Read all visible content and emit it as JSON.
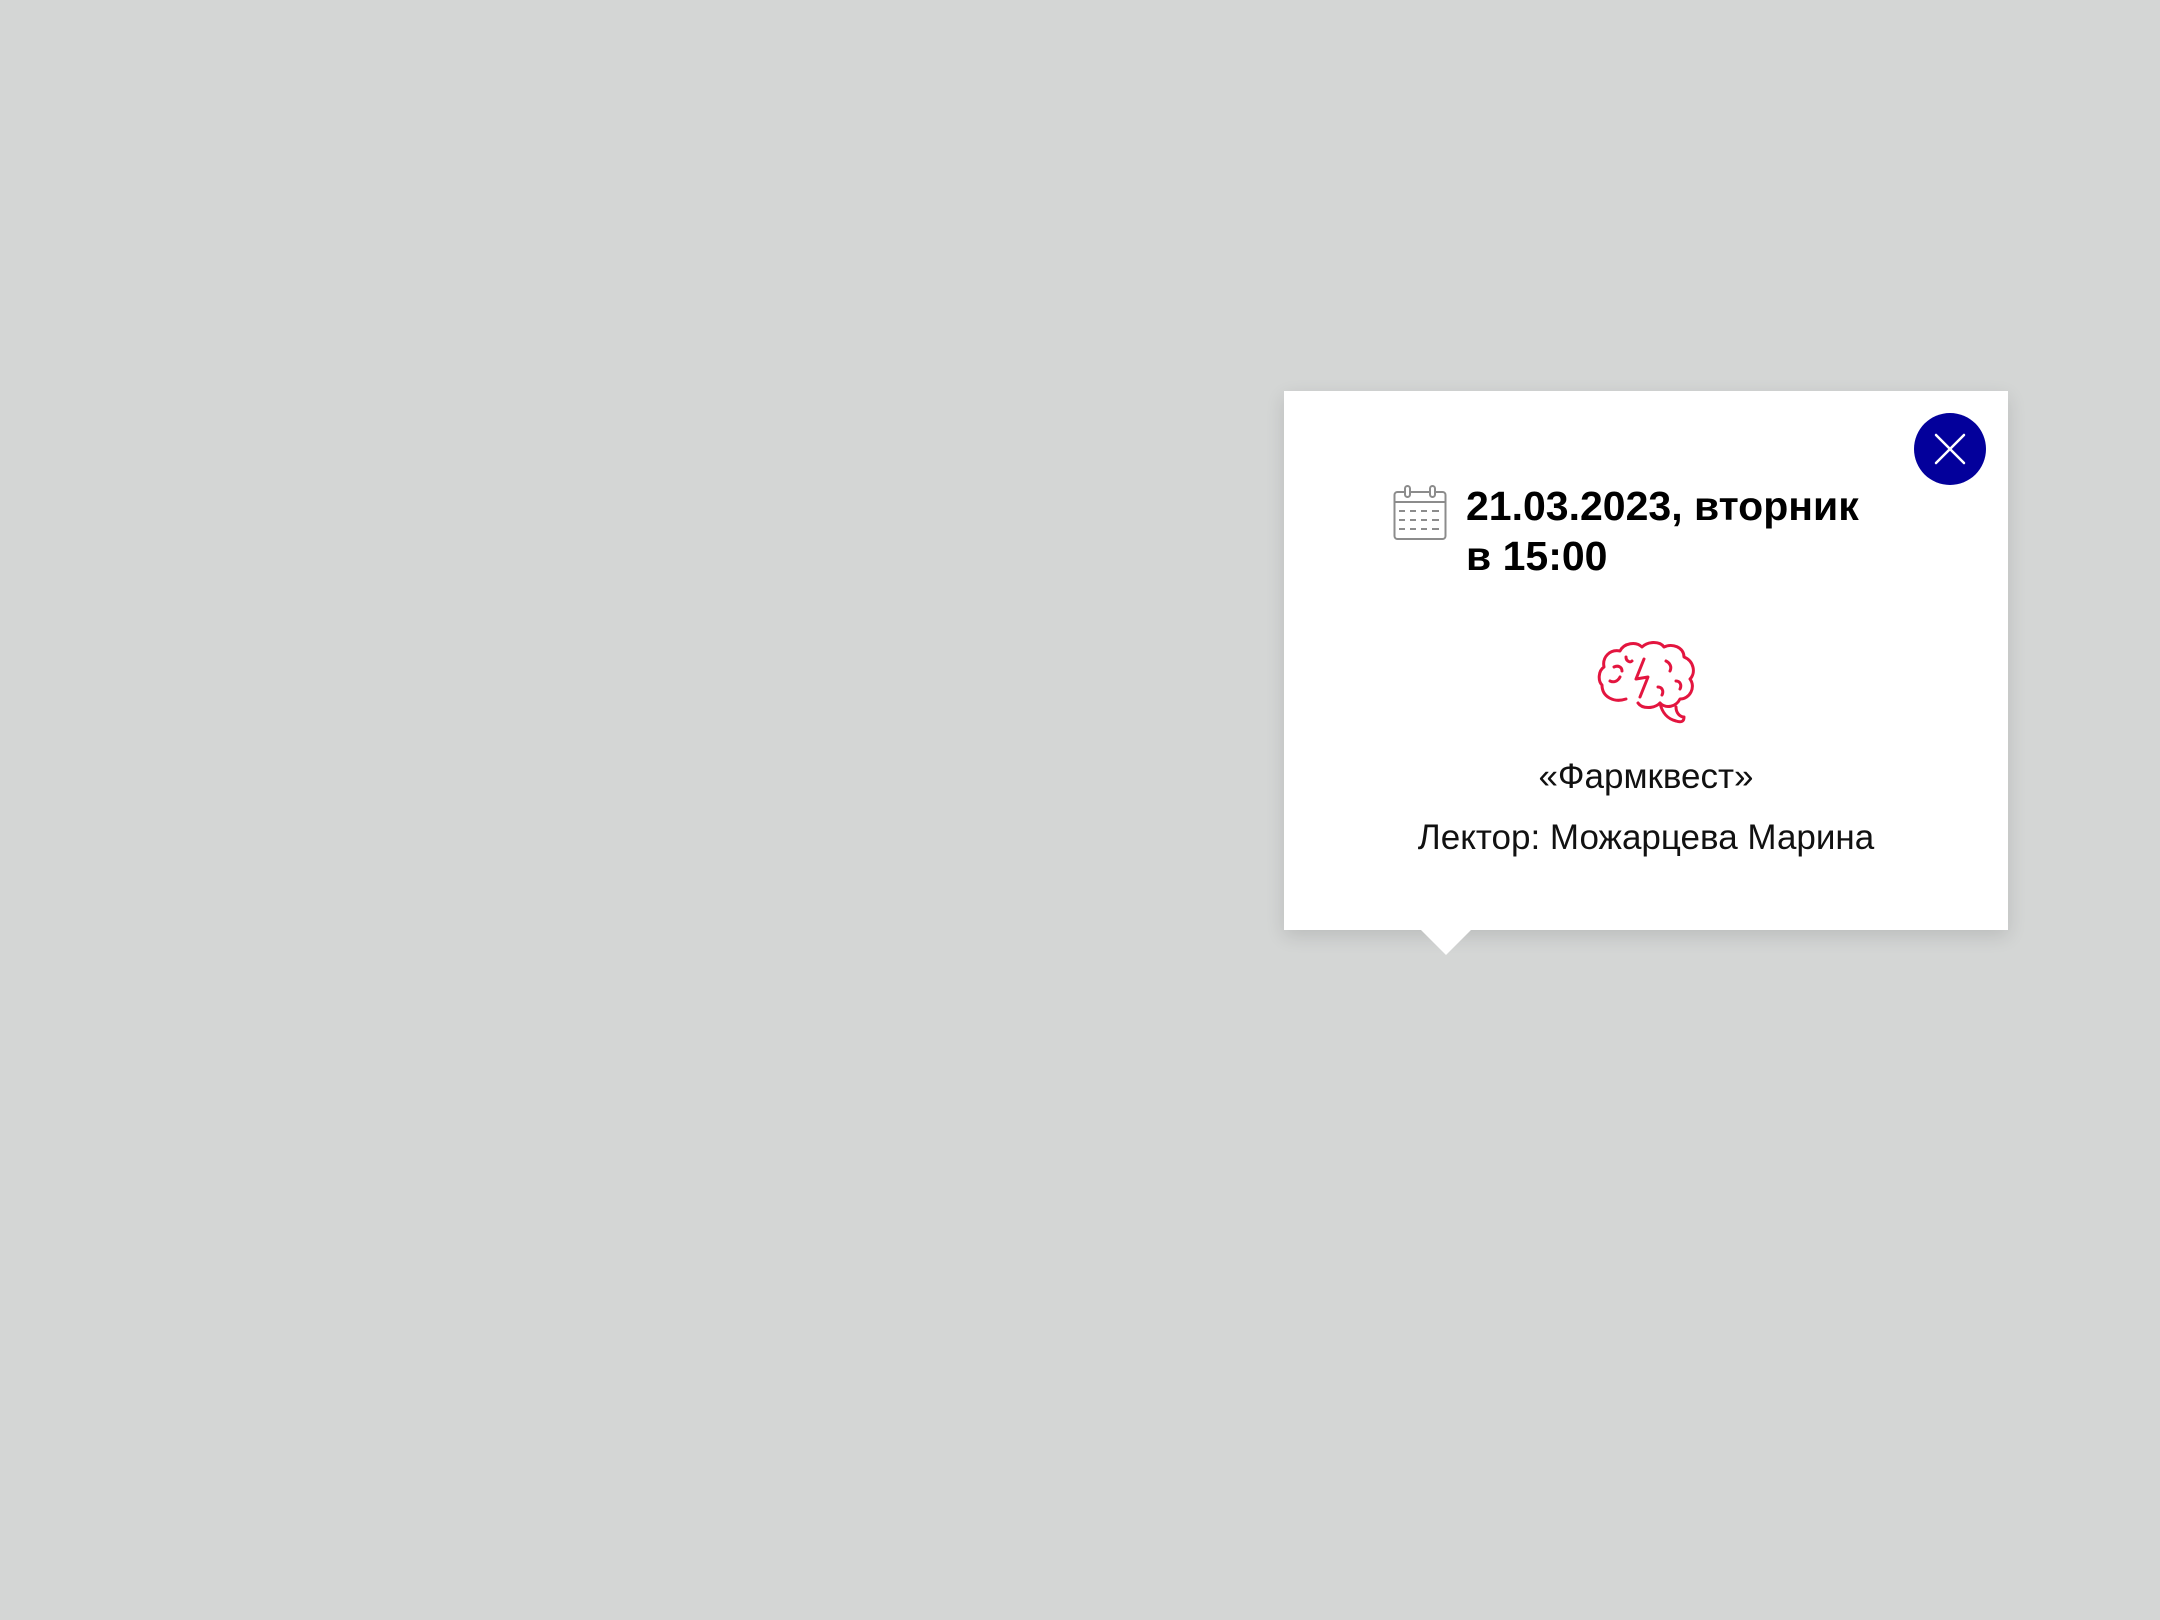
{
  "popup": {
    "date": "21.03.2023, вторник",
    "time": "в 15:00",
    "title": "«Фармквест»",
    "lecturer": "Лектор: Можарцева Марина",
    "icons": {
      "calendar": "calendar-icon",
      "topic": "brain-lightning-icon",
      "close": "close-icon"
    }
  },
  "colors": {
    "background": "#d4d6d5",
    "popup_background": "#ffffff",
    "close_button": "#03009b",
    "brain_icon": "#e3153f",
    "calendar_icon": "#8c8c8c",
    "text": "#000000"
  }
}
